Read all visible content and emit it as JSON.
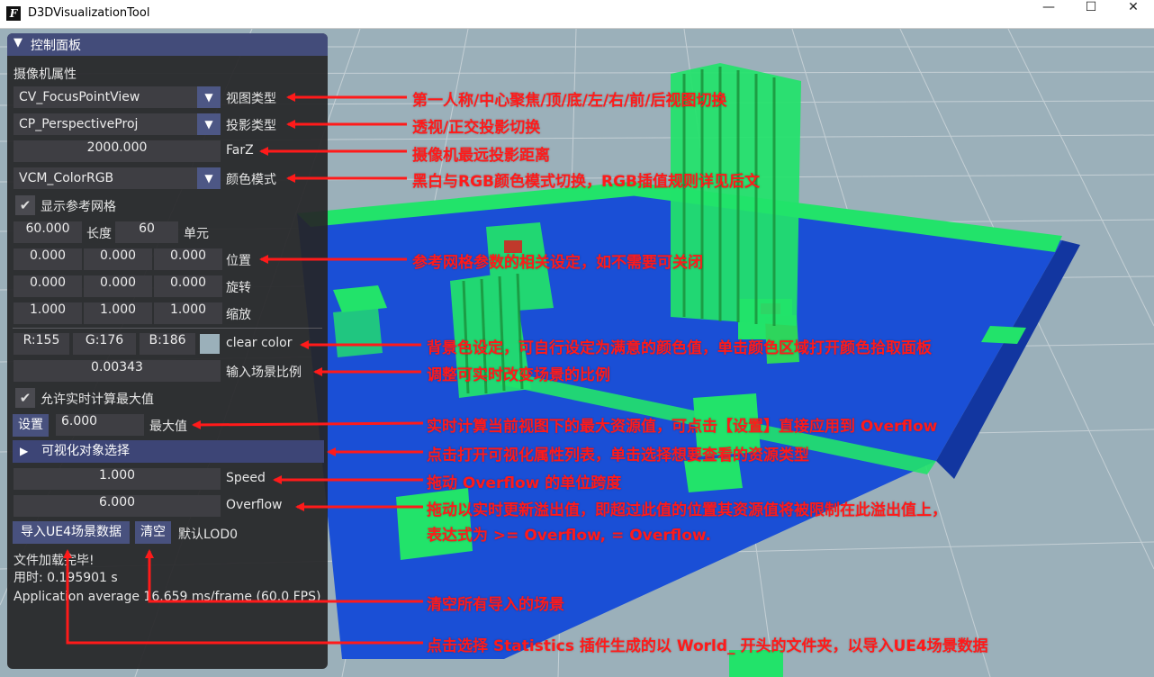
{
  "window": {
    "title": "D3DVisualizationTool",
    "minimize": "—",
    "maximize": "☐",
    "close": "✕"
  },
  "panel": {
    "header": "控制面板",
    "camera_section": "摄像机属性",
    "view_type": {
      "value": "CV_FocusPointView",
      "label": "视图类型"
    },
    "proj_type": {
      "value": "CP_PerspectiveProj",
      "label": "投影类型"
    },
    "farz": {
      "value": "2000.000",
      "label": "FarZ"
    },
    "color_mode": {
      "value": "VCM_ColorRGB",
      "label": "颜色模式"
    },
    "show_grid": {
      "checked": true,
      "label": "显示参考网格"
    },
    "grid_length": {
      "value": "60.000",
      "label": "长度"
    },
    "grid_cells": {
      "value": "60",
      "label": "单元"
    },
    "position": {
      "values": [
        "0.000",
        "0.000",
        "0.000"
      ],
      "label": "位置"
    },
    "rotation": {
      "values": [
        "0.000",
        "0.000",
        "0.000"
      ],
      "label": "旋转"
    },
    "scale": {
      "values": [
        "1.000",
        "1.000",
        "1.000"
      ],
      "label": "缩放"
    },
    "clear_color": {
      "r": "R:155",
      "g": "G:176",
      "b": "B:186",
      "label": "clear color",
      "hex": "#9bb0ba"
    },
    "scene_scale": {
      "value": "0.00343",
      "label": "输入场景比例"
    },
    "realtime_max": {
      "checked": true,
      "label": "允许实时计算最大值"
    },
    "set_button": "设置",
    "max_value": {
      "value": "6.000",
      "label": "最大值"
    },
    "vis_select": "可视化对象选择",
    "speed": {
      "value": "1.000",
      "label": "Speed"
    },
    "overflow": {
      "value": "6.000",
      "label": "Overflow"
    },
    "import_button": "导入UE4场景数据",
    "clear_button": "清空",
    "default_lod": "默认LOD0",
    "status_loaded": "文件加载完毕!",
    "status_time": "用时: 0.195901 s",
    "status_fps": "Application average 16.659 ms/frame (60.0 FPS)"
  },
  "annotations": {
    "view_type": "第一人称/中心聚焦/顶/底/左/右/前/后视图切换",
    "proj_type": "透视/正交投影切换",
    "farz": "摄像机最远投影距离",
    "color_mode": "黑白与RGB颜色模式切换，RGB插值规则详见后文",
    "grid": "参考网格参数的相关设定，如不需要可关闭",
    "clear_color": "背景色设定，可自行设定为满意的颜色值，单击颜色区域打开颜色拾取面板",
    "scene_scale": "调整可实时改变场景的比例",
    "max_value": "实时计算当前视图下的最大资源值，可点击【设置】直接应用到 Overflow",
    "vis_select": "点击打开可视化属性列表，单击选择想要查看的资源类型",
    "speed": "拖动 Overflow 的单位跨度",
    "overflow_1": "拖动以实时更新溢出值，即超过此值的位置其资源值将被限制在此溢出值上，",
    "overflow_2": "表达式为 >= Overflow, = Overflow.",
    "clear_button": "清空所有导入的场景",
    "import_button": "点击选择 Statistics 插件生成的以 World_ 开头的文件夹，以导入UE4场景数据"
  },
  "colors": {
    "background": "#9bb0ba",
    "accent": "#434c7a",
    "annotation": "#ff1a1a",
    "scene_blue": "#1a4fd6",
    "scene_green": "#22e36a"
  }
}
